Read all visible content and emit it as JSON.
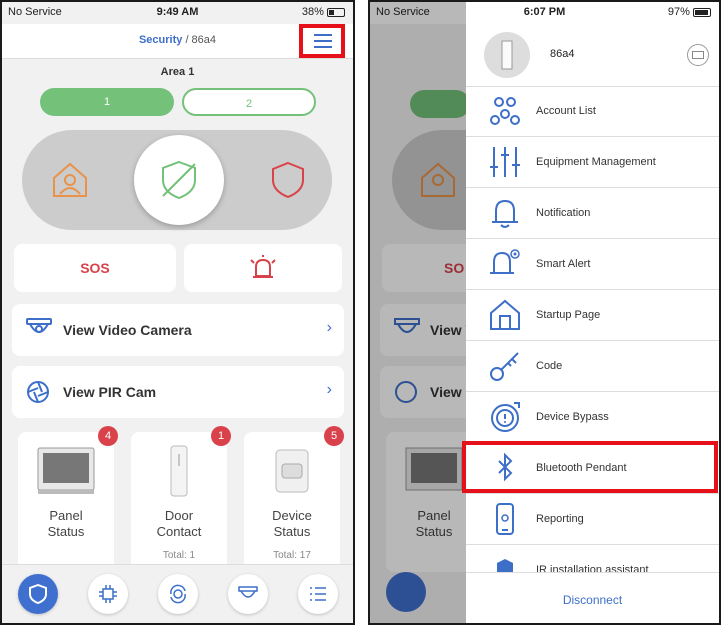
{
  "left": {
    "status": {
      "carrier": "No Service",
      "time": "9:49 AM",
      "battery": "38%"
    },
    "header": {
      "title": "Security",
      "subtitle": "/ 86a4"
    },
    "area_label": "Area 1",
    "partitions": [
      "1",
      "2"
    ],
    "sos_label": "SOS",
    "rows": [
      {
        "label": "View Video Camera",
        "icon": "camera-icon"
      },
      {
        "label": "View PIR Cam",
        "icon": "aperture-icon"
      }
    ],
    "cards": [
      {
        "line1": "Panel",
        "line2": "Status",
        "badge": "4",
        "total": ""
      },
      {
        "line1": "Door",
        "line2": "Contact",
        "badge": "1",
        "total": "Total: 1"
      },
      {
        "line1": "Device",
        "line2": "Status",
        "badge": "5",
        "total": "Total: 17"
      }
    ]
  },
  "right": {
    "status": {
      "carrier": "No Service",
      "time": "6:07 PM",
      "battery": "97%"
    },
    "drawer": {
      "account_name": "86a4",
      "items": [
        {
          "label": "Account List",
          "icon": "users-icon"
        },
        {
          "label": "Equipment Management",
          "icon": "sliders-icon"
        },
        {
          "label": "Notification",
          "icon": "bell-icon"
        },
        {
          "label": "Smart Alert",
          "icon": "smart-bell-icon"
        },
        {
          "label": "Startup Page",
          "icon": "home-icon"
        },
        {
          "label": "Code",
          "icon": "key-icon"
        },
        {
          "label": "Device Bypass",
          "icon": "bypass-icon"
        },
        {
          "label": "Bluetooth Pendant",
          "icon": "bluetooth-icon"
        },
        {
          "label": "Reporting",
          "icon": "phone-icon"
        },
        {
          "label": "IR installation assistant",
          "icon": "cube-icon"
        }
      ],
      "disconnect_label": "Disconnect"
    },
    "bg": {
      "sos_partial": "SO",
      "row1_partial": "View V",
      "row2_partial": "View P",
      "card_line1": "Panel",
      "card_line2": "Status"
    }
  },
  "colors": {
    "accent": "#3d6fc9",
    "green": "#74c17a",
    "red": "#d9424a",
    "highlight": "#e5101a"
  }
}
